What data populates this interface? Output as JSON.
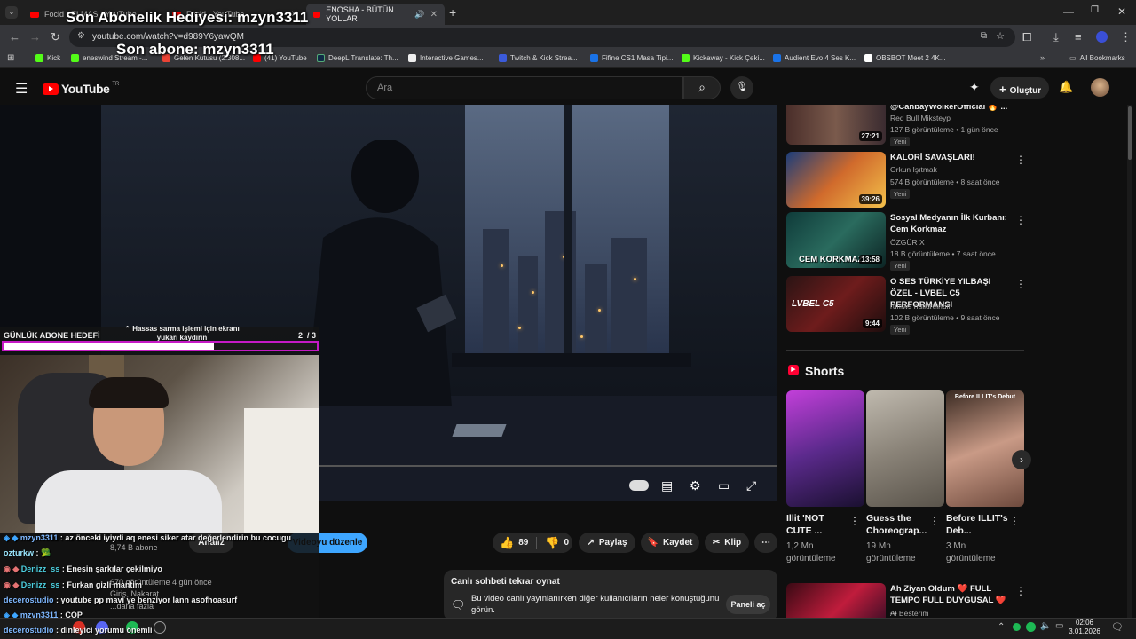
{
  "tabs": [
    {
      "label": "Focid - ELMAS - YouTube",
      "active": false
    },
    {
      "label": "Focid - YouTube",
      "active": false
    },
    {
      "label": "ENOSHA - BÜTÜN YOLLAR",
      "active": true
    }
  ],
  "new_tab": "+",
  "address": "youtube.com/watch?v=d989Y6yawQM",
  "bookmarks": [
    {
      "label": "Kick",
      "color": "#53fc18"
    },
    {
      "label": "eneswind Stream -...",
      "color": "#53fc18"
    },
    {
      "label": "Gelen Kutusu (2.308...",
      "color": "#ea4335"
    },
    {
      "label": "(41) YouTube",
      "color": "#ff0000"
    },
    {
      "label": "DeepL Translate: Th...",
      "color": "#0f2b46"
    },
    {
      "label": "Interactive Games...",
      "color": "#eeeeee"
    },
    {
      "label": "Twitch & Kick Strea...",
      "color": "#3b5bdb"
    },
    {
      "label": "Fifine CS1 Masa Tipi...",
      "color": "#1a73e8"
    },
    {
      "label": "Kickaway - Kick Çeki...",
      "color": "#53fc18"
    },
    {
      "label": "Audient Evo 4 Ses K...",
      "color": "#1a73e8"
    },
    {
      "label": "OBSBOT Meet 2 4K...",
      "color": "#ffffff"
    }
  ],
  "all_bookmarks": "All Bookmarks",
  "overlay": {
    "line1": "Son Abonelik Hediyesi: mzyn3311",
    "line2": "Son abone: mzyn3311"
  },
  "youtube": {
    "logo": "YouTube",
    "country": "TR",
    "search_placeholder": "Ara",
    "create_label": "Oluştur"
  },
  "recommended": [
    {
      "title": "@CanbayWolkerOfficial 🔥 ...",
      "channel": "Red Bull Mikstеyp",
      "meta": "127 B görüntüleme • 1 gün önce",
      "badge": "Yeni",
      "duration": "27:21"
    },
    {
      "title": "KALORİ SAVAŞLARI!",
      "channel": "Orkun Işıtmak",
      "meta": "574 B görüntüleme • 8 saat önce",
      "badge": "Yeni",
      "duration": "39:26"
    },
    {
      "title": "Sosyal Medyanın İlk Kurbanı: Cem Korkmaz",
      "channel": "ÖZGÜR X",
      "meta": "18 B görüntüleme • 7 saat önce",
      "badge": "Yeni",
      "duration": "13:58",
      "thumb_text": "CEM KORKMAZ"
    },
    {
      "title": "O SES TÜRKİYE YILBAŞI ÖZEL - LVBEL C5 PERFORMANSI",
      "channel": "rufflws nulldreinull",
      "meta": "102 B görüntüleme • 9 saat önce",
      "badge": "Yeni",
      "duration": "9:44",
      "thumb_text": "LVBEL C5"
    }
  ],
  "shorts_heading": "Shorts",
  "shorts": [
    {
      "title": "Illit 'NOT CUTE ...",
      "views": "1,2 Mn görüntüleme"
    },
    {
      "title": "Guess the Choreograp...",
      "views": "19 Mn görüntüleme"
    },
    {
      "title": "Before ILLIT's Deb...",
      "views": "3 Mn görüntüleme",
      "thumb_text": "Before ILLIT's Debut"
    }
  ],
  "last_rec": {
    "title": "Ah Ziyan Oldum ❤️ FULL TEMPO FULL DUYGUSAL ❤️ ...",
    "channel": "Al Besterim"
  },
  "actions": {
    "likes": "89",
    "dislikes": "0",
    "share": "Paylaş",
    "save": "Kaydet",
    "clip": "Klip",
    "edit_video": "Videoyu düzenle",
    "analytics": "Analiz",
    "subscriber_count": "8,74 B abone"
  },
  "description": {
    "views": "670 görüntüleme  4 gün önce",
    "line": "Giriş, Nakarat",
    "more": "...daha fazla"
  },
  "livechat": {
    "title": "Canlı sohbeti tekrar oynat",
    "body": "Bu video canlı yayınlanırken diğer kullanıcıların neler konuştuğunu görün.",
    "button": "Paneli aç"
  },
  "goal": {
    "label": "GÜNLÜK ABONE HEDEFİ",
    "hint": "⌃ Hassas sarma işlemi için ekranı yukarı kaydırın",
    "count": "2  / 3",
    "progress": 0.67
  },
  "chat": [
    {
      "user": "mzyn3311",
      "text": ": az önceki iyiydi aq enesi siker atar değerlendirin bu cocugu"
    },
    {
      "user": "ozturkw",
      "text": ": 🥦"
    },
    {
      "user": "Denizz_ss",
      "text": ": Enesin şarkılar çekilmiyo"
    },
    {
      "user": "Denizz_ss",
      "text": ": Furkan gizli mantim"
    },
    {
      "user": "decerostudio",
      "text": ": youtube pp mavi ye benziyor lann asofhoasurf"
    },
    {
      "user": "mzyn3311",
      "text": ": ÇÖP"
    },
    {
      "user": "decerostudio",
      "text": ": dinleyici yorumu önemli"
    }
  ],
  "taskbar": {
    "time": "02:06",
    "date": "3.01.2026"
  }
}
